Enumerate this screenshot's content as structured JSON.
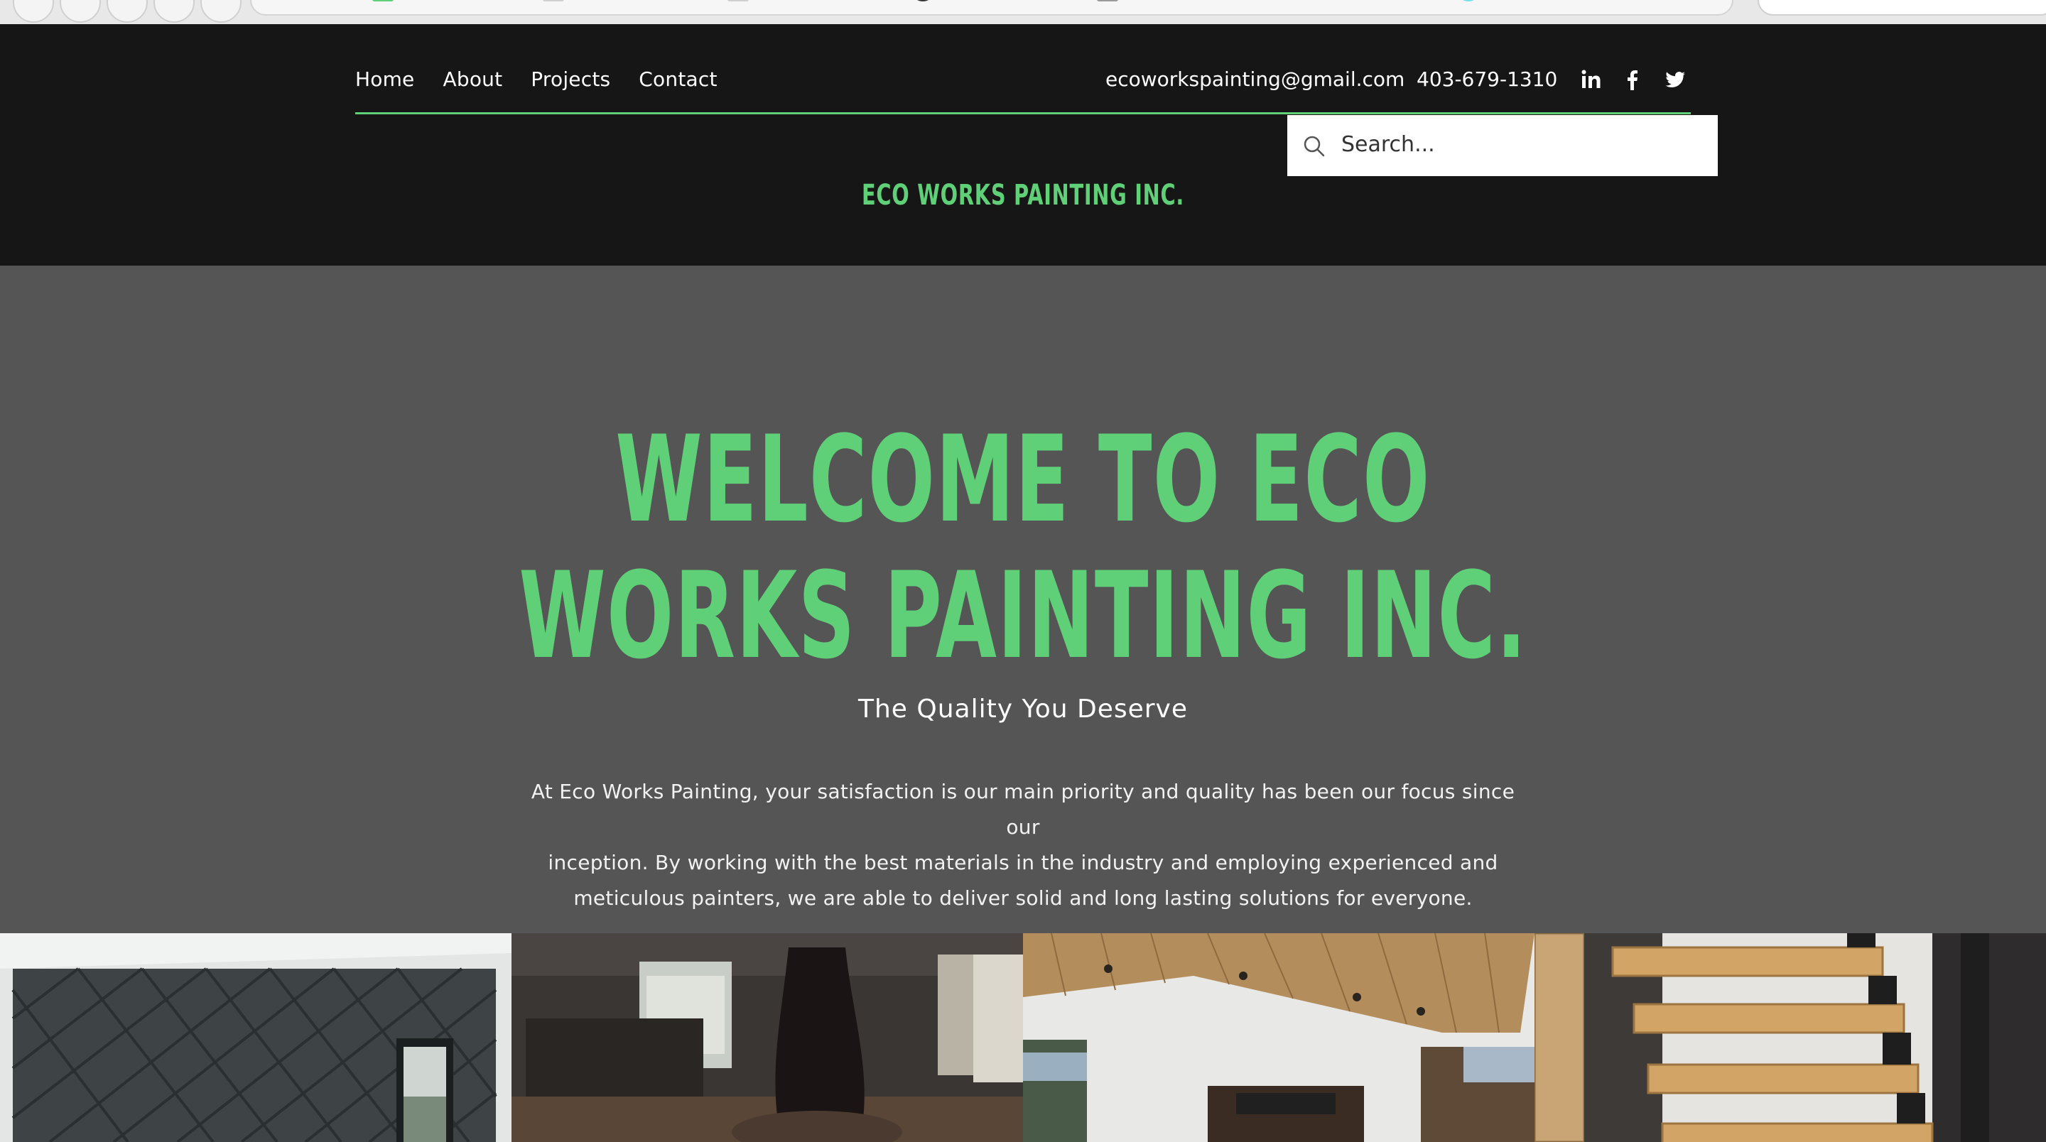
{
  "nav": {
    "items": [
      {
        "label": "Home"
      },
      {
        "label": "About"
      },
      {
        "label": "Projects"
      },
      {
        "label": "Contact"
      }
    ]
  },
  "contact": {
    "email": "ecoworkspainting@gmail.com",
    "phone": "403-679-1310"
  },
  "social": [
    "linkedin-icon",
    "facebook-icon",
    "twitter-icon"
  ],
  "search": {
    "placeholder": "Search..."
  },
  "brand": {
    "name": "ECO WORKS PAINTING INC."
  },
  "hero": {
    "title_line1": "WELCOME TO ECO",
    "title_line2": "WORKS PAINTING INC.",
    "subtitle": "The Quality You Deserve",
    "body_line1": "At Eco Works Painting, your satisfaction is our main priority and quality has been our focus since our",
    "body_line2": "inception. By working with the best materials in the industry and employing experienced and",
    "body_line3": "meticulous painters, we are able to deliver solid and long lasting solutions for everyone."
  },
  "colors": {
    "accent": "#5fcf78",
    "header_bg": "#161616",
    "hero_bg": "#555555"
  }
}
